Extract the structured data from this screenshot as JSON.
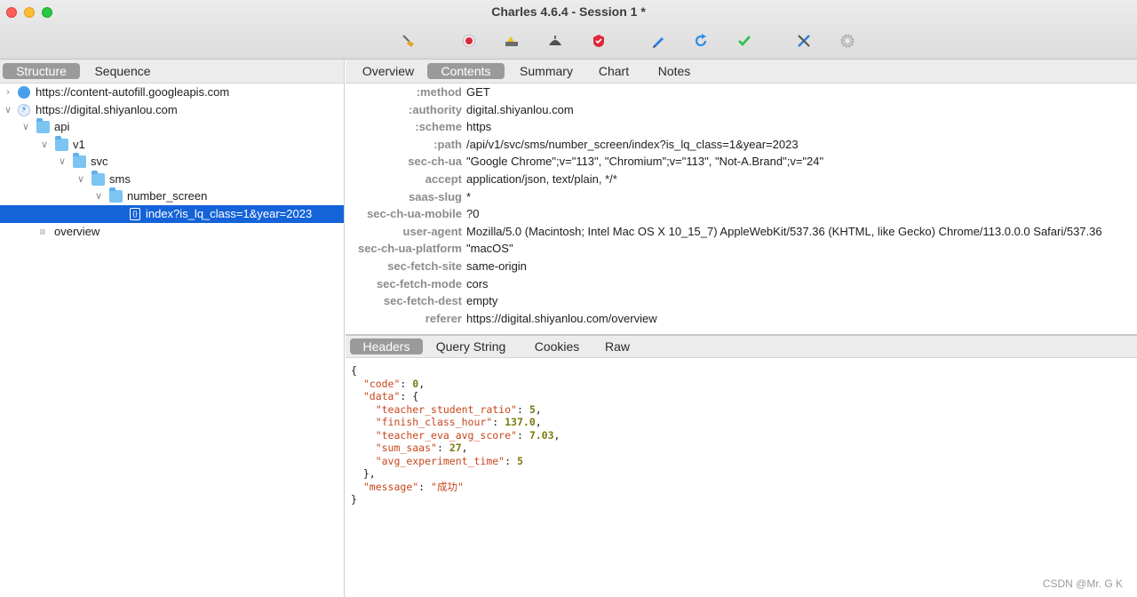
{
  "window": {
    "title": "Charles 4.6.4 - Session 1 *"
  },
  "toolbar": {
    "icons": [
      "broom-icon",
      "record-icon",
      "throttle-icon",
      "breakpoints-icon",
      "ssl-icon",
      "compose-icon",
      "repeat-icon",
      "validate-icon",
      "tools-icon",
      "settings-icon"
    ]
  },
  "left": {
    "tabs": {
      "structure": "Structure",
      "sequence": "Sequence"
    },
    "tree": [
      {
        "label": "https://content-autofill.googleapis.com"
      },
      {
        "label": "https://digital.shiyanlou.com"
      },
      {
        "label": "api"
      },
      {
        "label": "v1"
      },
      {
        "label": "svc"
      },
      {
        "label": "sms"
      },
      {
        "label": "number_screen"
      },
      {
        "label": "index?is_lq_class=1&year=2023"
      },
      {
        "label": "overview"
      }
    ]
  },
  "right": {
    "tabs": [
      "Overview",
      "Contents",
      "Summary",
      "Chart",
      "Notes"
    ],
    "request_headers": [
      {
        "key": ":method",
        "value": "GET"
      },
      {
        "key": ":authority",
        "value": "digital.shiyanlou.com"
      },
      {
        "key": ":scheme",
        "value": "https"
      },
      {
        "key": ":path",
        "value": "/api/v1/svc/sms/number_screen/index?is_lq_class=1&year=2023"
      },
      {
        "key": "sec-ch-ua",
        "value": "\"Google Chrome\";v=\"113\", \"Chromium\";v=\"113\", \"Not-A.Brand\";v=\"24\""
      },
      {
        "key": "accept",
        "value": "application/json, text/plain, */*"
      },
      {
        "key": "saas-slug",
        "value": "*"
      },
      {
        "key": "sec-ch-ua-mobile",
        "value": "?0"
      },
      {
        "key": "user-agent",
        "value": "Mozilla/5.0 (Macintosh; Intel Mac OS X 10_15_7) AppleWebKit/537.36 (KHTML, like Gecko) Chrome/113.0.0.0 Safari/537.36"
      },
      {
        "key": "sec-ch-ua-platform",
        "value": "\"macOS\""
      },
      {
        "key": "sec-fetch-site",
        "value": "same-origin"
      },
      {
        "key": "sec-fetch-mode",
        "value": "cors"
      },
      {
        "key": "sec-fetch-dest",
        "value": "empty"
      },
      {
        "key": "referer",
        "value": "https://digital.shiyanlou.com/overview"
      }
    ],
    "response_tabs": [
      "Headers",
      "Query String",
      "Cookies",
      "Raw"
    ],
    "response_json": {
      "code_key": "\"code\"",
      "code_val": "0",
      "data_key": "\"data\"",
      "f1_key": "\"teacher_student_ratio\"",
      "f1_val": "5",
      "f2_key": "\"finish_class_hour\"",
      "f2_val": "137.0",
      "f3_key": "\"teacher_eva_avg_score\"",
      "f3_val": "7.03",
      "f4_key": "\"sum_saas\"",
      "f4_val": "27",
      "f5_key": "\"avg_experiment_time\"",
      "f5_val": "5",
      "msg_key": "\"message\"",
      "msg_val": "\"成功\""
    }
  },
  "watermark": "CSDN @Mr. G K"
}
